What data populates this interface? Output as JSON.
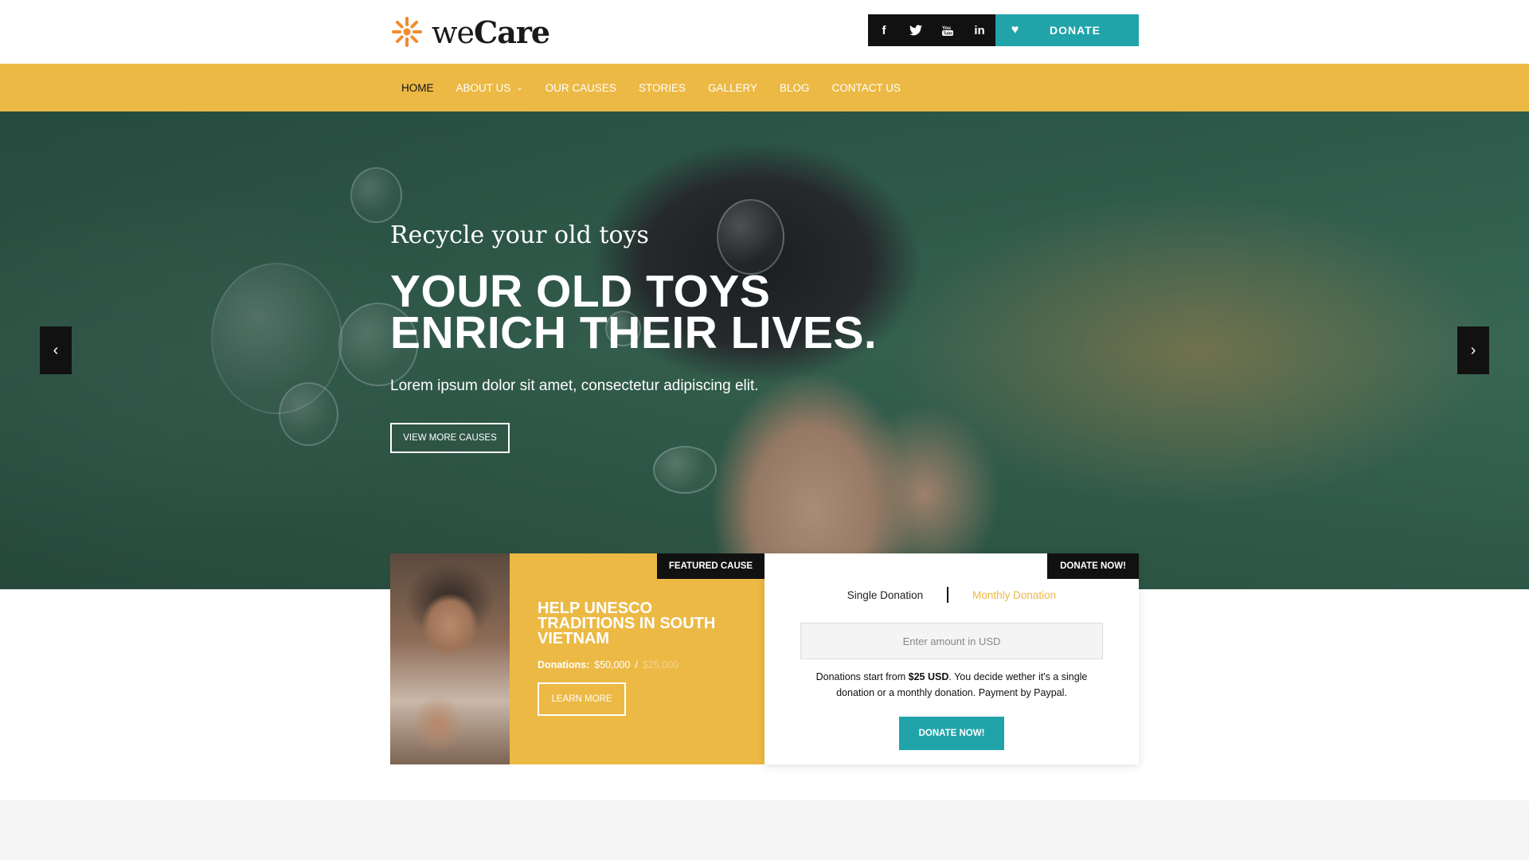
{
  "brand": {
    "name_light": "we",
    "name_bold": "Care",
    "accent": "#ecb945",
    "teal": "#20a4a9",
    "logo_color": "#f28b2c"
  },
  "header": {
    "social": [
      {
        "icon": "facebook-icon",
        "glyph": "f"
      },
      {
        "icon": "twitter-icon",
        "glyph": "🐦"
      },
      {
        "icon": "youtube-icon",
        "glyph": "▶"
      },
      {
        "icon": "linkedin-icon",
        "glyph": "in"
      }
    ],
    "donate_label": "DONATE"
  },
  "nav": {
    "items": [
      {
        "label": "HOME",
        "active": true
      },
      {
        "label": "ABOUT US",
        "dropdown": true
      },
      {
        "label": "OUR CAUSES"
      },
      {
        "label": "STORIES"
      },
      {
        "label": "GALLERY"
      },
      {
        "label": "BLOG"
      },
      {
        "label": "CONTACT US"
      }
    ]
  },
  "hero": {
    "subtitle": "Recycle your old toys",
    "title_line1": "YOUR OLD TOYS",
    "title_line2": "ENRICH THEIR LIVES.",
    "text": "Lorem ipsum dolor sit amet, consectetur adipiscing elit.",
    "button": "VIEW MORE CAUSES",
    "prev": "‹",
    "next": "›"
  },
  "featured": {
    "tag": "FEATURED CAUSE",
    "title": "HELP UNESCO TRADITIONS IN SOUTH VIETNAM",
    "donations_label": "Donations:",
    "raised": "$50,000",
    "separator": "/",
    "goal": "$25,000",
    "button": "LEARN MORE"
  },
  "donate_box": {
    "tag": "DONATE NOW!",
    "tab_single": "Single Donation",
    "tab_monthly": "Monthly Donation",
    "amount_placeholder": "Enter amount in USD",
    "info_pre": "Donations start from ",
    "info_amount": "$25 USD",
    "info_post": ". You decide wether it's a single donation or a monthly donation. Payment by Paypal.",
    "button": "DONATE NOW!"
  }
}
